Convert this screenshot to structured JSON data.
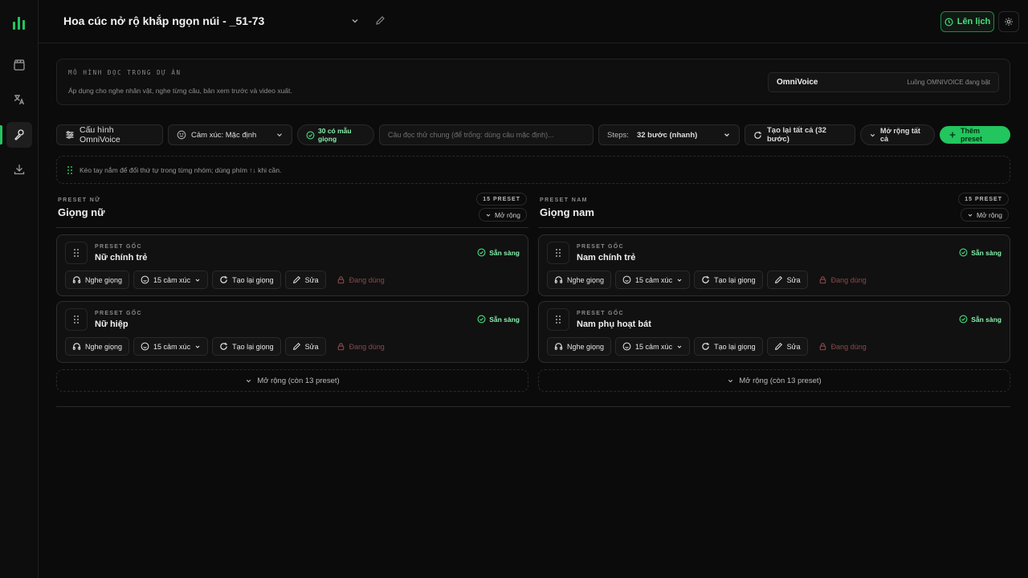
{
  "app": {
    "title": "Hoa cúc nở rộ khắp ngọn núi - _51-73",
    "schedule_label": "Lên lịch",
    "accent": "#22c55e"
  },
  "sidebar": {
    "items": [
      {
        "icon": "clapperboard-icon"
      },
      {
        "icon": "translate-icon"
      },
      {
        "icon": "voice-tool-icon",
        "active": true
      },
      {
        "icon": "download-icon"
      }
    ]
  },
  "model_panel": {
    "label": "MÔ HÌNH ĐỌC TRONG DỰ ÁN",
    "description": "Áp dụng cho nghe nhân vật, nghe từng câu, bản xem trước và video xuất.",
    "selected_model": "OmniVoice",
    "status": "Luồng OMNIVOICE đang bật"
  },
  "toolbar": {
    "config_label": "Cấu hình OmniVoice",
    "emotion_label": "Cảm xúc: Mặc định",
    "samples_badge": "30 có mẫu giọng",
    "sentence_placeholder": "Câu đọc thử chung (để trống: dùng câu mặc định)...",
    "steps_label": "Steps:",
    "steps_value": "32 bước (nhanh)",
    "regenerate_all_label": "Tạo lại tất cả (32 bước)",
    "expand_all_label": "Mở rộng tất cả",
    "add_preset_label": "Thêm preset"
  },
  "hint": "Kéo tay nắm để đổi thứ tự trong từng nhóm; dùng phím ↑↓ khi cần.",
  "columns": [
    {
      "kicker": "PRESET NỮ",
      "title": "Giọng nữ",
      "count": "15 PRESET",
      "expand_label": "Mở rộng",
      "more_label": "Mở rộng (còn 13 preset)",
      "cards": [
        {
          "kicker": "PRESET GỐC",
          "name": "Nữ chính trẻ",
          "status": "Sẵn sàng"
        },
        {
          "kicker": "PRESET GỐC",
          "name": "Nữ hiệp",
          "status": "Sẵn sàng"
        }
      ]
    },
    {
      "kicker": "PRESET NAM",
      "title": "Giọng nam",
      "count": "15 PRESET",
      "expand_label": "Mở rộng",
      "more_label": "Mở rộng (còn 13 preset)",
      "cards": [
        {
          "kicker": "PRESET GỐC",
          "name": "Nam chính trẻ",
          "status": "Sẵn sàng"
        },
        {
          "kicker": "PRESET GỐC",
          "name": "Nam phụ hoạt bát",
          "status": "Sẵn sàng"
        }
      ]
    }
  ],
  "card_actions": {
    "listen": "Nghe giọng",
    "emotions": "15 cảm xúc",
    "regenerate": "Tạo lại giọng",
    "edit": "Sửa",
    "in_use": "Đang dùng"
  }
}
